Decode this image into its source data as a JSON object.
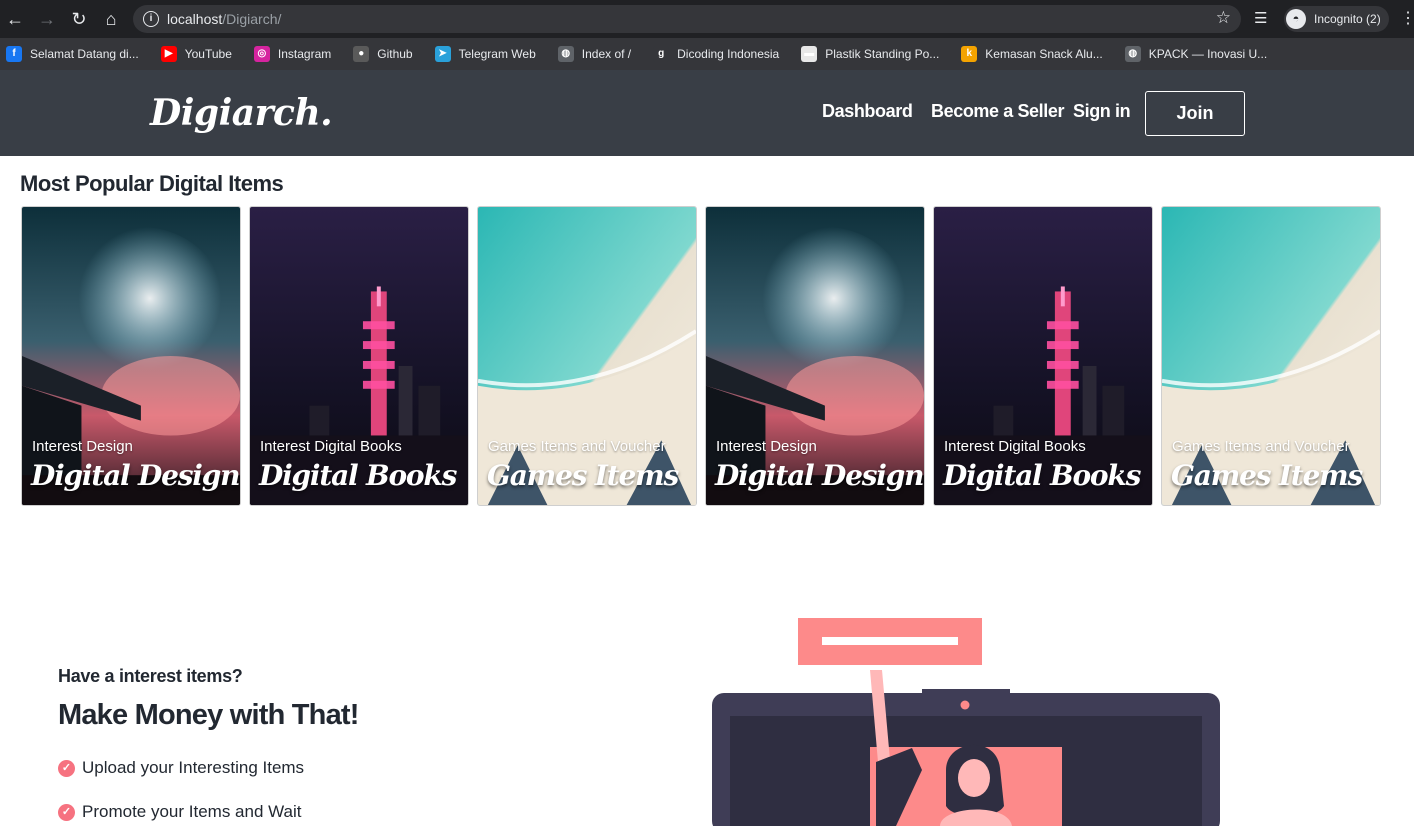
{
  "browser": {
    "url_host": "localhost",
    "url_path": "/Digiarch/",
    "incognito_label": "Incognito (2)",
    "bookmarks": [
      {
        "label": "Selamat Datang di...",
        "icon": "facebook-icon",
        "color": "#1877f2",
        "glyph": "f"
      },
      {
        "label": "YouTube",
        "icon": "youtube-icon",
        "color": "#ff0000",
        "glyph": "▶"
      },
      {
        "label": "Instagram",
        "icon": "instagram-icon",
        "color": "#d6249f",
        "glyph": "◎"
      },
      {
        "label": "Github",
        "icon": "github-icon",
        "color": "#5a5a5a",
        "glyph": "●"
      },
      {
        "label": "Telegram Web",
        "icon": "telegram-icon",
        "color": "#2aa1da",
        "glyph": "➤"
      },
      {
        "label": "Index of /",
        "icon": "globe-icon",
        "color": "#5f6368",
        "glyph": "◍"
      },
      {
        "label": "Dicoding Indonesia",
        "icon": "dicoding-icon",
        "color": "#35363a",
        "glyph": "g"
      },
      {
        "label": "Plastik Standing Po...",
        "icon": "plastik-icon",
        "color": "#e8e8e8",
        "glyph": "▬"
      },
      {
        "label": "Kemasan Snack Alu...",
        "icon": "kemasan-icon",
        "color": "#f4a300",
        "glyph": "k"
      },
      {
        "label": "KPACK — Inovasi U...",
        "icon": "globe-icon",
        "color": "#5f6368",
        "glyph": "◍"
      }
    ]
  },
  "header": {
    "brand": "Digiarch.",
    "nav": {
      "dashboard": "Dashboard",
      "seller": "Become a Seller",
      "signin": "Sign in",
      "join": "Join"
    }
  },
  "popular": {
    "title": "Most Popular Digital Items",
    "cards": [
      {
        "subtitle": "Interest Design",
        "title": "Digital Design",
        "theme": "fireworks"
      },
      {
        "subtitle": "Interest Digital Books",
        "title": "Digital Books",
        "theme": "tower"
      },
      {
        "subtitle": "Games Items and Voucher",
        "title": "Games Items",
        "theme": "beach"
      },
      {
        "subtitle": "Interest Design",
        "title": "Digital Design",
        "theme": "fireworks"
      },
      {
        "subtitle": "Interest Digital Books",
        "title": "Digital Books",
        "theme": "tower"
      },
      {
        "subtitle": "Games Items and Voucher",
        "title": "Games Items",
        "theme": "beach"
      }
    ]
  },
  "sell": {
    "pre": "Have a interest items?",
    "title": "Make Money with That!",
    "features": [
      "Upload your Interesting Items",
      "Promote your Items and Wait"
    ]
  },
  "colors": {
    "header_bg": "#393e46",
    "accent": "#f67280",
    "text_dark": "#222831"
  }
}
